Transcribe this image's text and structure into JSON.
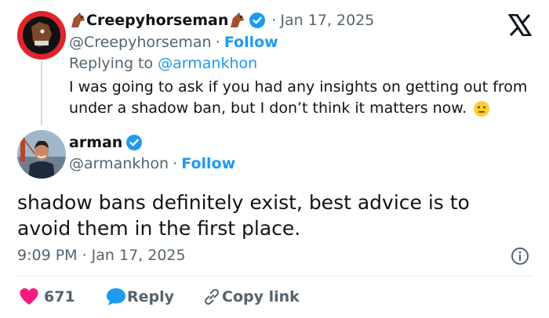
{
  "colors": {
    "accent": "#1d9bf0",
    "like": "#f91880",
    "muted": "#536471",
    "text": "#0f1419"
  },
  "reply_tweet": {
    "display_name": "Creepyhorseman",
    "handle": "@Creepyhorseman",
    "date": "Jan 17, 2025",
    "follow_label": "Follow",
    "replying_prefix": "Replying to ",
    "replying_handle": "@armankhon",
    "text_line1": "I was going to ask if you had any insights on getting out from",
    "text_line2": "under a shadow ban, but I don’t think it matters now.",
    "emoji": "neutral-face-emoji"
  },
  "main_tweet": {
    "display_name": "arman",
    "handle": "@armankhon",
    "follow_label": "Follow",
    "text_line1": "shadow bans definitely exist, best advice is to",
    "text_line2": "avoid them in the first place.",
    "timestamp": "9:09 PM · Jan 17, 2025"
  },
  "actions": {
    "like_count": "671",
    "reply_label": "Reply",
    "copy_link_label": "Copy link"
  },
  "icons": [
    "x-logo-icon",
    "verified-badge-icon",
    "horse-emoji-icon",
    "info-icon",
    "heart-icon",
    "reply-bubble-icon",
    "link-icon"
  ],
  "separator": "·"
}
